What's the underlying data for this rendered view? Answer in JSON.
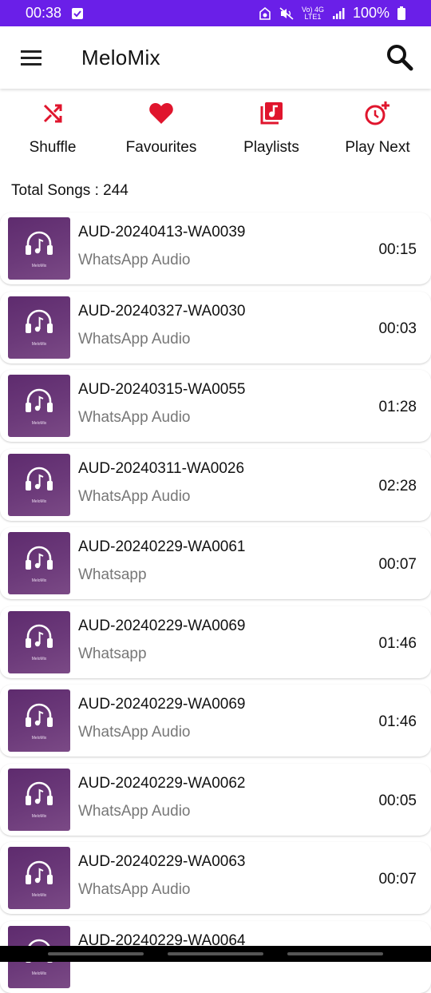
{
  "status_bar": {
    "time": "00:38",
    "network_top": "Vo) 4G",
    "network_bottom": "LTE1",
    "battery": "100%"
  },
  "app_bar": {
    "title": "MeloMix",
    "menu_icon": "hamburger-menu-icon",
    "search_icon": "search-icon"
  },
  "actions": [
    {
      "label": "Shuffle",
      "icon": "shuffle-icon"
    },
    {
      "label": "Favourites",
      "icon": "heart-icon"
    },
    {
      "label": "Playlists",
      "icon": "playlist-icon"
    },
    {
      "label": "Play Next",
      "icon": "clock-plus-icon"
    }
  ],
  "accent_color": "#e0152d",
  "total_songs": "Total Songs : 244",
  "album_art_brand": "MeloMix",
  "songs": [
    {
      "title": "AUD-20240413-WA0039",
      "artist": "WhatsApp Audio",
      "duration": "00:15"
    },
    {
      "title": "AUD-20240327-WA0030",
      "artist": "WhatsApp Audio",
      "duration": "00:03"
    },
    {
      "title": "AUD-20240315-WA0055",
      "artist": "WhatsApp Audio",
      "duration": "01:28"
    },
    {
      "title": "AUD-20240311-WA0026",
      "artist": "WhatsApp Audio",
      "duration": "02:28"
    },
    {
      "title": "AUD-20240229-WA0061",
      "artist": "Whatsapp",
      "duration": "00:07"
    },
    {
      "title": "AUD-20240229-WA0069",
      "artist": "Whatsapp",
      "duration": "01:46"
    },
    {
      "title": "AUD-20240229-WA0069",
      "artist": "WhatsApp Audio",
      "duration": "01:46"
    },
    {
      "title": "AUD-20240229-WA0062",
      "artist": "WhatsApp Audio",
      "duration": "00:05"
    },
    {
      "title": "AUD-20240229-WA0063",
      "artist": "WhatsApp Audio",
      "duration": "00:07"
    },
    {
      "title": "AUD-20240229-WA0064",
      "artist": "",
      "duration": ""
    }
  ]
}
